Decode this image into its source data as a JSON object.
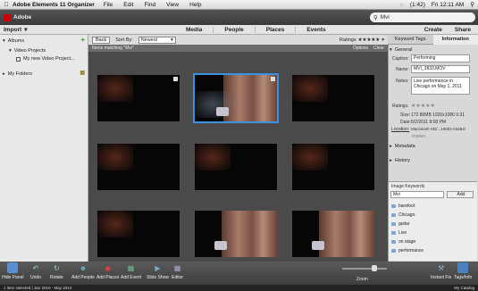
{
  "menubar": {
    "app": "Adobe Elements 11 Organizer",
    "items": [
      "File",
      "Edit",
      "Find",
      "View",
      "Help"
    ],
    "battery": "(1:42)",
    "clock": "Fri 12:11 AM"
  },
  "appbar": {
    "brand": "Adobe",
    "search_value": "Mvi"
  },
  "moderow": {
    "import": "Import",
    "tabs": [
      "Media",
      "People",
      "Places",
      "Events"
    ],
    "create": "Create",
    "share": "Share"
  },
  "leftpanel": {
    "albums": "Albums",
    "folder_group": "Video Projects",
    "project": "My new Video Project...",
    "my_folders": "My Folders"
  },
  "subbar": {
    "back": "Back",
    "sort_label": "Sort By:",
    "sort_value": "Newest",
    "ratings": "Ratings",
    "matching": "Items matching \"Mvi\"",
    "options": "Options",
    "clear": "Clear"
  },
  "rightpanel": {
    "tab_tags": "Keyword Tags",
    "tab_info": "Information",
    "general": "General",
    "caption_label": "Caption:",
    "caption_value": "Performing",
    "name_label": "Name:",
    "name_value": "MVI_3833.MOV",
    "notes_label": "Notes:",
    "notes_value": "Live performance in Chicago on May 1, 2011",
    "ratings_label": "Ratings:",
    "size_label": "Size:",
    "size_value": "172.80MB  1920x1080  0:31",
    "date_label": "Date:",
    "date_value": "5/2/2011 8:08 PM",
    "location_label": "Location:",
    "location_value": "Macintosh HD/...10002-23484/",
    "location_extra": "<none>",
    "metadata": "Metadata",
    "history": "History",
    "image_keywords": "Image Keywords",
    "kw_input": "Mvi",
    "add": "Add",
    "keywords": [
      "barefoot",
      "Chicago",
      "guitar",
      "Live",
      "on stage",
      "performance"
    ]
  },
  "bottombar": {
    "tools": [
      "Hide Panel",
      "Undo",
      "Rotate",
      "Add People",
      "Add Places",
      "Add Event",
      "Slide Show",
      "Editor"
    ],
    "zoom": "Zoom",
    "instant_fix": "Instant Fix",
    "tags_info": "Tags/Info"
  },
  "statusbar": {
    "left": "1 item selected | Jan 2010 - May 2012",
    "right": "My Catalog"
  }
}
